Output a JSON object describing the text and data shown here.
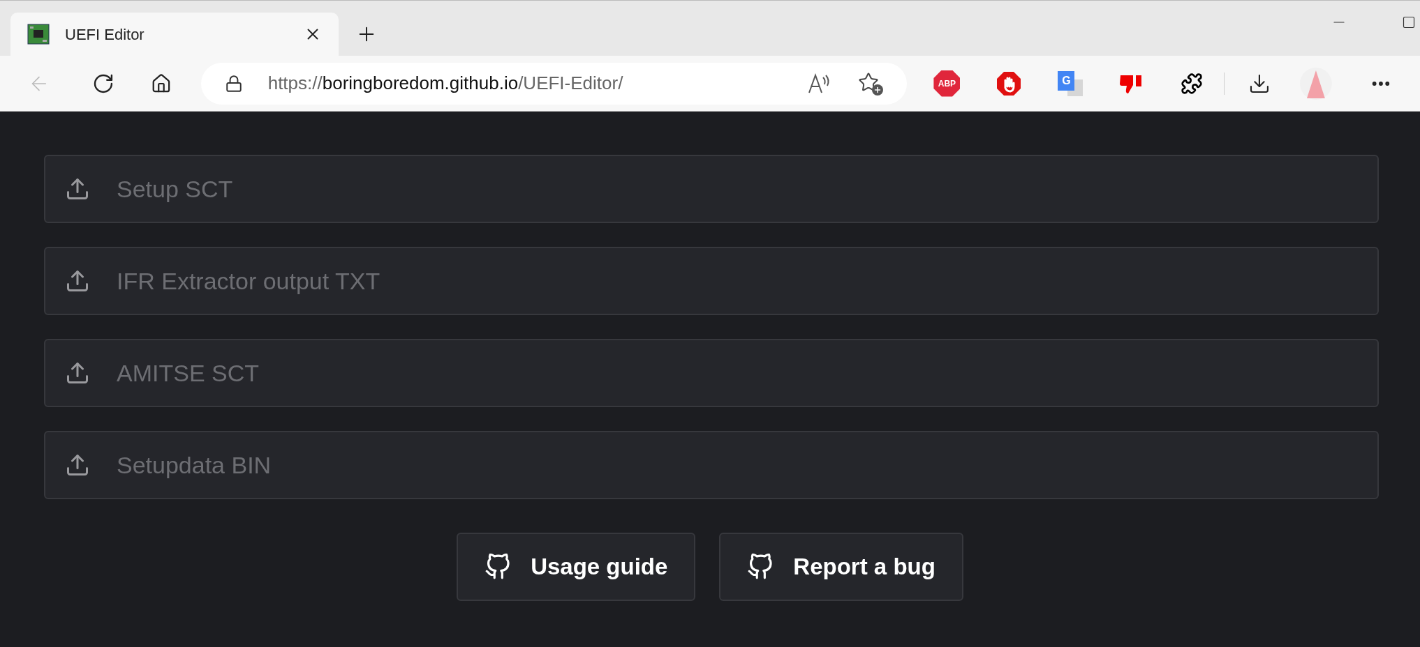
{
  "tab": {
    "title": "UEFI Editor",
    "selected": true
  },
  "toolbar": {
    "back": {
      "disabled": true
    },
    "url": {
      "scheme": "https://",
      "host": "boringboredom.github.io",
      "path": "/UEFI-Editor/"
    }
  },
  "extensions": [
    {
      "kind": "abp",
      "label": "ABP"
    },
    {
      "kind": "stop"
    },
    {
      "kind": "translate",
      "label": "G"
    },
    {
      "kind": "dislike"
    },
    {
      "kind": "puzzle"
    }
  ],
  "file_inputs": [
    {
      "label": "Setup SCT"
    },
    {
      "label": "IFR Extractor output TXT"
    },
    {
      "label": "AMITSE SCT"
    },
    {
      "label": "Setupdata BIN"
    }
  ],
  "buttons": [
    {
      "label": "Usage guide"
    },
    {
      "label": "Report a bug"
    }
  ]
}
